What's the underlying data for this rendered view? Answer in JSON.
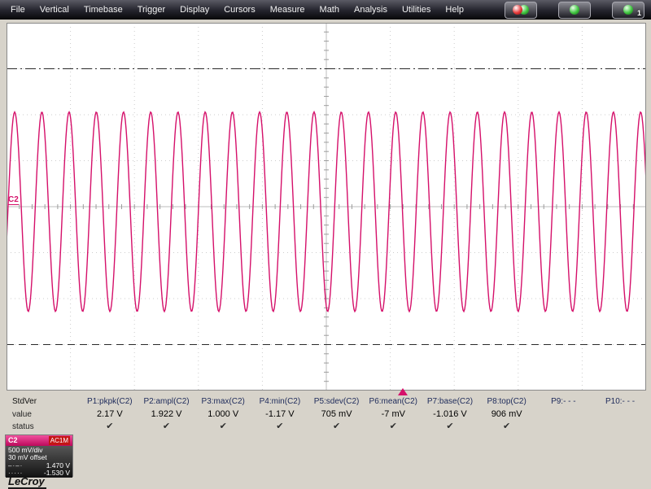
{
  "menu": {
    "items": [
      "File",
      "Vertical",
      "Timebase",
      "Trigger",
      "Display",
      "Cursors",
      "Measure",
      "Math",
      "Analysis",
      "Utilities",
      "Help"
    ],
    "icons": [
      {
        "name": "lecroy-logo-icon",
        "badge": ""
      },
      {
        "name": "autosetup-icon",
        "badge": ""
      },
      {
        "name": "panel-one-icon",
        "badge": "1"
      }
    ]
  },
  "scope": {
    "channel_marker": "C2"
  },
  "measurements": {
    "table_label": "StdVer",
    "row_labels": {
      "value": "value",
      "status": "status"
    },
    "columns": [
      {
        "header": "P1:pkpk(C2)",
        "value": "2.17 V",
        "status": "✔"
      },
      {
        "header": "P2:ampl(C2)",
        "value": "1.922 V",
        "status": "✔"
      },
      {
        "header": "P3:max(C2)",
        "value": "1.000 V",
        "status": "✔"
      },
      {
        "header": "P4:min(C2)",
        "value": "-1.17 V",
        "status": "✔"
      },
      {
        "header": "P5:sdev(C2)",
        "value": "705 mV",
        "status": "✔"
      },
      {
        "header": "P6:mean(C2)",
        "value": "-7 mV",
        "status": "✔"
      },
      {
        "header": "P7:base(C2)",
        "value": "-1.016 V",
        "status": "✔"
      },
      {
        "header": "P8:top(C2)",
        "value": "906 mV",
        "status": "✔"
      },
      {
        "header": "P9:- - -",
        "value": "",
        "status": ""
      },
      {
        "header": "P10:- - -",
        "value": "",
        "status": ""
      }
    ]
  },
  "channel_descriptor": {
    "channel": "C2",
    "coupling": "AC1M",
    "scale": "500 mV/div",
    "offset": "30 mV offset",
    "levels": [
      {
        "style": "dash-dot",
        "glyph": "–·–·",
        "value": "1.470 V"
      },
      {
        "style": "dotted",
        "glyph": "·····",
        "value": "-1.530 V"
      }
    ]
  },
  "branding": {
    "logo": "LeCroy"
  },
  "chart_data": {
    "type": "line",
    "signal": "sine",
    "channel": "C2",
    "trace_color": "#d5106a",
    "volts_per_div": 0.5,
    "offset_v": 0.03,
    "time_divs": 10,
    "vertical_divs": 8,
    "cycles_visible": 23.5,
    "max_v": 1.0,
    "min_v": -1.17,
    "pkpk_v": 2.17,
    "ampl_v": 1.922,
    "sdev_v": 0.705,
    "mean_v": -0.007,
    "base_v": -1.016,
    "top_v": 0.906,
    "cursor_levels_v": [
      1.47,
      -1.53
    ],
    "trigger_position_frac": 0.62,
    "grid_on": true
  }
}
